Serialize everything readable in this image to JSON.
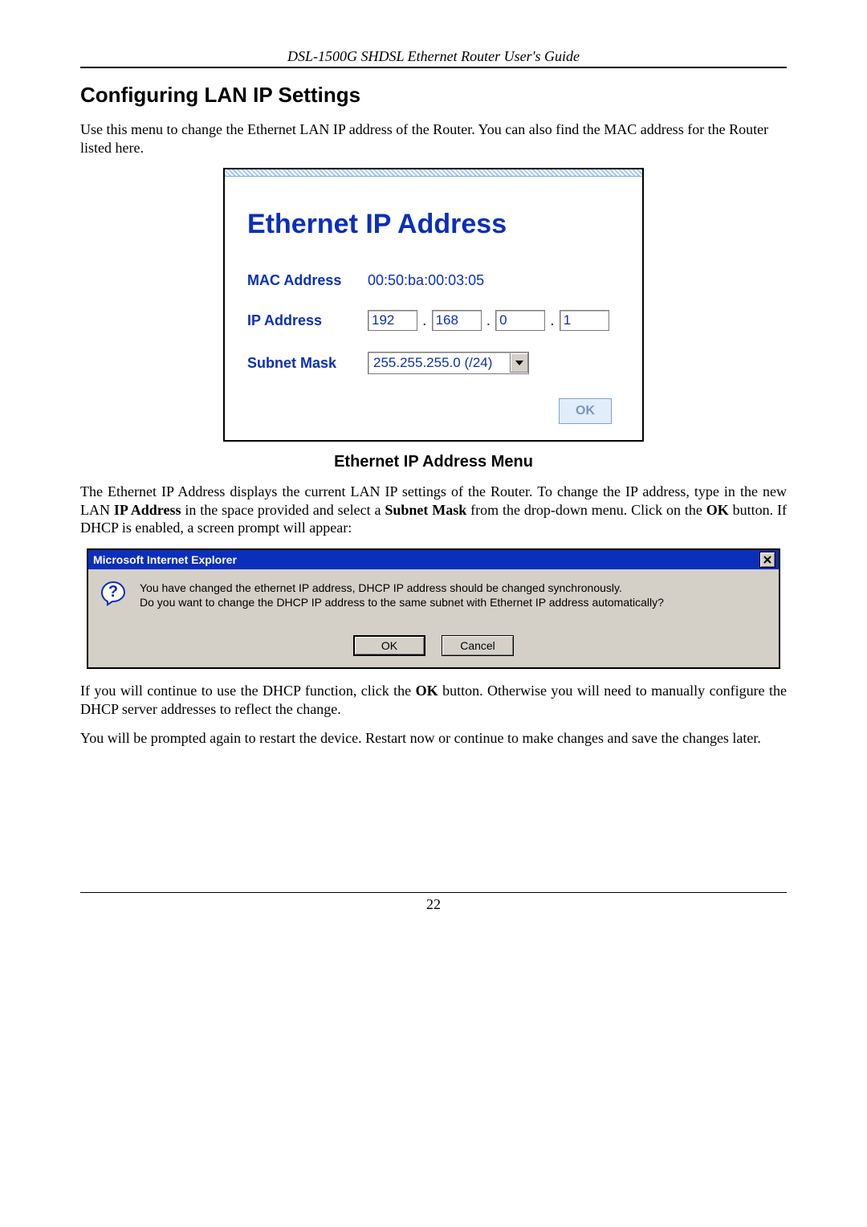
{
  "doc_header": "DSL-1500G SHDSL Ethernet Router User's Guide",
  "section_title": "Configuring LAN IP Settings",
  "intro_text": "Use this menu to change the Ethernet LAN IP address of the Router. You can also find the MAC address for the Router listed here.",
  "panel": {
    "title": "Ethernet IP Address",
    "mac_label": "MAC Address",
    "mac_value": "00:50:ba:00:03:05",
    "ip_label": "IP Address",
    "ip_octets": [
      "192",
      "168",
      "0",
      "1"
    ],
    "subnet_label": "Subnet Mask",
    "subnet_value": "255.255.255.0 (/24)",
    "ok_label": "OK"
  },
  "figure_caption": "Ethernet IP Address Menu",
  "para_after_panel": {
    "prefix": "The Ethernet IP Address displays the current LAN IP settings of the Router. To change the IP address, type in the new LAN ",
    "b1": "IP Address",
    "mid1": " in the space provided and select a ",
    "b2": "Subnet Mask",
    "mid2": " from the drop-down menu. Click on the ",
    "b3": "OK",
    "suffix": " button. If DHCP is enabled, a screen prompt will appear:"
  },
  "dialog": {
    "title": "Microsoft Internet Explorer",
    "line1": "You have changed the ethernet IP address, DHCP IP address should be changed synchronously.",
    "line2": "Do you want to change the DHCP IP address to the same subnet with Ethernet IP address automatically?",
    "nbsp": " ",
    "ok_label": "OK",
    "cancel_label": "Cancel"
  },
  "para_after_dialog": {
    "prefix": "If you will continue to use the DHCP function, click the ",
    "b1": "OK",
    "suffix": " button. Otherwise you will need to manually configure the DHCP server addresses to reflect the change."
  },
  "final_para": "You will be prompted again to restart the device. Restart now or continue to make changes and save the changes later.",
  "page_number": "22"
}
